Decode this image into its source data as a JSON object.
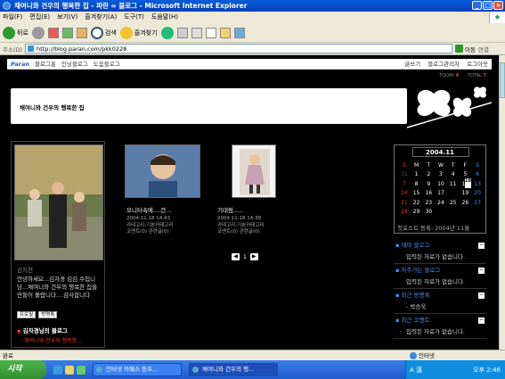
{
  "window": {
    "title": "채여니와 건우의 행복한 집 - 파란 ∞ 블로그 - Microsoft Internet Explorer"
  },
  "menu": [
    "파일(F)",
    "편집(E)",
    "보기(V)",
    "즐겨찾기(A)",
    "도구(T)",
    "도움말(H)"
  ],
  "toolbar": {
    "back": "뒤로",
    "search": "검색",
    "favorites": "즐겨찾기"
  },
  "address": {
    "label": "주소(D)",
    "url": "http://blog.paran.com/pkk0228",
    "go": "이동",
    "links": "연결"
  },
  "blognav": {
    "brand": "Paran",
    "items": [
      "블로그홈",
      "인닝블로그",
      "도움블로그"
    ],
    "right": [
      "글쓰기",
      "블로그관리자",
      "로그아웃"
    ]
  },
  "visits": {
    "today_label": "TODAY",
    "today": "4",
    "total_label": "TOTAL",
    "total": "7"
  },
  "banner": {
    "title": "채여니와 건우의 행복한 집"
  },
  "profile": {
    "name": "김지현",
    "intro": "안녕하세요...김자경 김김 수입니당...채여니와 건우의 행복한 집을 만들어 볼랍니다....감사합니다",
    "buttons": [
      "프로필",
      "방명록"
    ],
    "friend_title": "김자경님의 블로그",
    "friend_link": "- 채여니와 건우의 행복한..."
  },
  "posts": [
    {
      "title": "모니터속에....건...",
      "date": "2004.11.18 14:43",
      "category": "카테고리:기본카테고리",
      "counts": "코멘트(0)  관련글(0)"
    },
    {
      "title": "기대림.....",
      "date": "2004.11.18 14:38",
      "category": "카테고리:기본카테고리",
      "counts": "코멘트(0)  관련글(0)"
    }
  ],
  "pager": {
    "page": "1",
    "prev": "◀",
    "next": "▶"
  },
  "calendar": {
    "month": "2004.11",
    "weekdays": [
      "S",
      "M",
      "T",
      "W",
      "T",
      "F",
      "S"
    ],
    "weeks": [
      [
        "31",
        "1",
        "2",
        "3",
        "4",
        "5",
        "6"
      ],
      [
        "7",
        "8",
        "9",
        "10",
        "11",
        "12",
        "13"
      ],
      [
        "14",
        "15",
        "16",
        "17",
        "18",
        "19",
        "20"
      ],
      [
        "21",
        "22",
        "23",
        "24",
        "25",
        "26",
        "27"
      ],
      [
        "28",
        "29",
        "30",
        "",
        "",
        "",
        ""
      ]
    ],
    "today": "18"
  },
  "first_post": {
    "label": "첫포스트 등록:",
    "value": "2004년 11월"
  },
  "right_boxes": [
    {
      "title": "태마 블로그",
      "body": "입력된 자료가 없습니다."
    },
    {
      "title": "자주가는 블로그",
      "body": "입력된 자료가 없습니다."
    },
    {
      "title": "최근 방명록",
      "body": "- 박승욱"
    },
    {
      "title": "최근 코멘트",
      "body": "입력된 자료가 없습니다."
    }
  ],
  "status": {
    "text": "완료",
    "zone": "인터넷"
  },
  "taskbar": {
    "start": "시작",
    "tasks": [
      "인터넷 카페스 등호...",
      "채여니와 건우의 행..."
    ],
    "ime": "A 漢",
    "clock": "오후 2:46"
  }
}
